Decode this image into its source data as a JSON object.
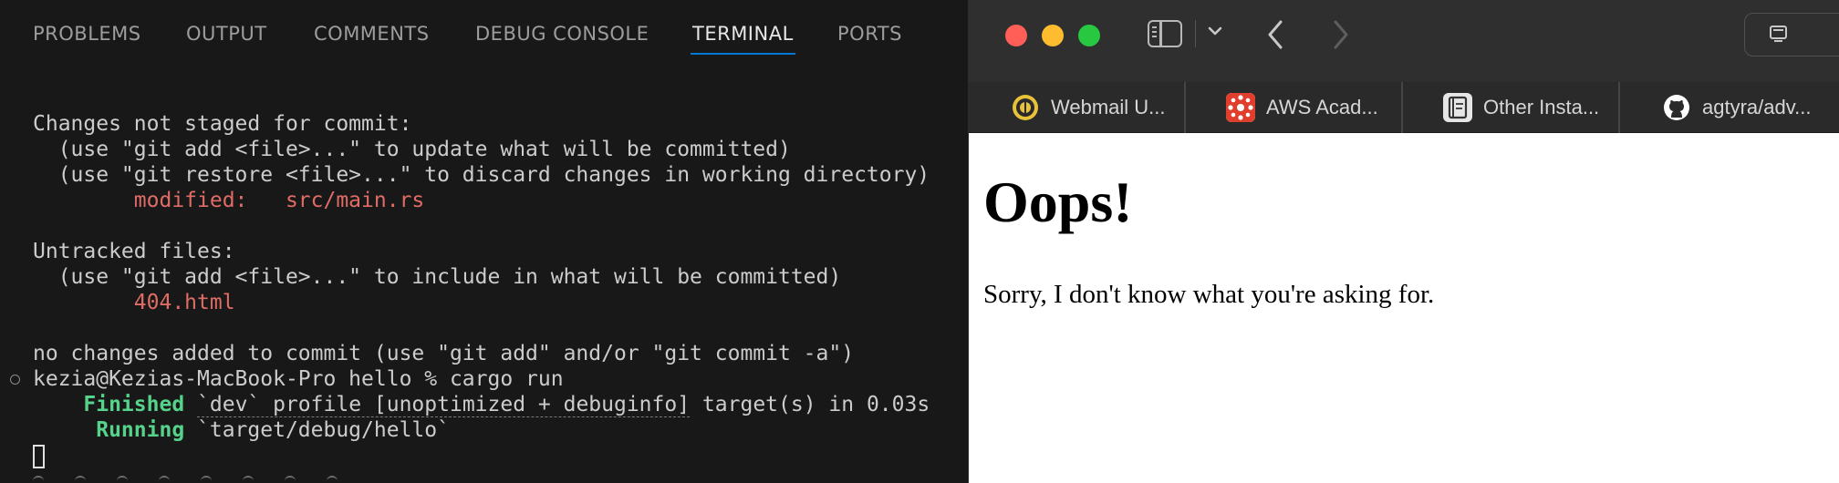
{
  "vscode": {
    "panel_tabs": [
      {
        "label": "PROBLEMS",
        "active": false
      },
      {
        "label": "OUTPUT",
        "active": false
      },
      {
        "label": "COMMENTS",
        "active": false
      },
      {
        "label": "DEBUG CONSOLE",
        "active": false
      },
      {
        "label": "TERMINAL",
        "active": true
      },
      {
        "label": "PORTS",
        "active": false
      }
    ],
    "terminal": {
      "not_staged_header": "Changes not staged for commit:",
      "hint_add_update": "  (use \"git add <file>...\" to update what will be committed)",
      "hint_restore": "  (use \"git restore <file>...\" to discard changes in working directory)",
      "modified_label": "        modified:",
      "modified_file": "   src/main.rs",
      "untracked_header": "Untracked files:",
      "hint_add_include": "  (use \"git add <file>...\" to include in what will be committed)",
      "untracked_file": "        404.html",
      "no_changes": "no changes added to commit (use \"git add\" and/or \"git commit -a\")",
      "prompt": "kezia@Kezias-MacBook-Pro hello % cargo run",
      "finished_label": "    Finished",
      "finished_pre": " ",
      "finished_profile": "`dev` profile [unoptimized + debuginfo]",
      "finished_post": " target(s) in 0.03s",
      "running_label": "     Running",
      "running_rest": " `target/debug/hello`"
    }
  },
  "browser": {
    "favorites": [
      {
        "label": "Webmail U...",
        "icon": "university-seal-icon"
      },
      {
        "label": "AWS Acad...",
        "icon": "canvas-icon"
      },
      {
        "label": "Other Insta...",
        "icon": "notebook-icon"
      },
      {
        "label": "agtyra/adv...",
        "icon": "github-icon"
      }
    ],
    "page": {
      "heading": "Oops!",
      "message": "Sorry, I don't know what you're asking for."
    },
    "colors": {
      "traffic_close": "#ff5f57",
      "traffic_minimize": "#febc2e",
      "traffic_maximize": "#28c840"
    }
  }
}
